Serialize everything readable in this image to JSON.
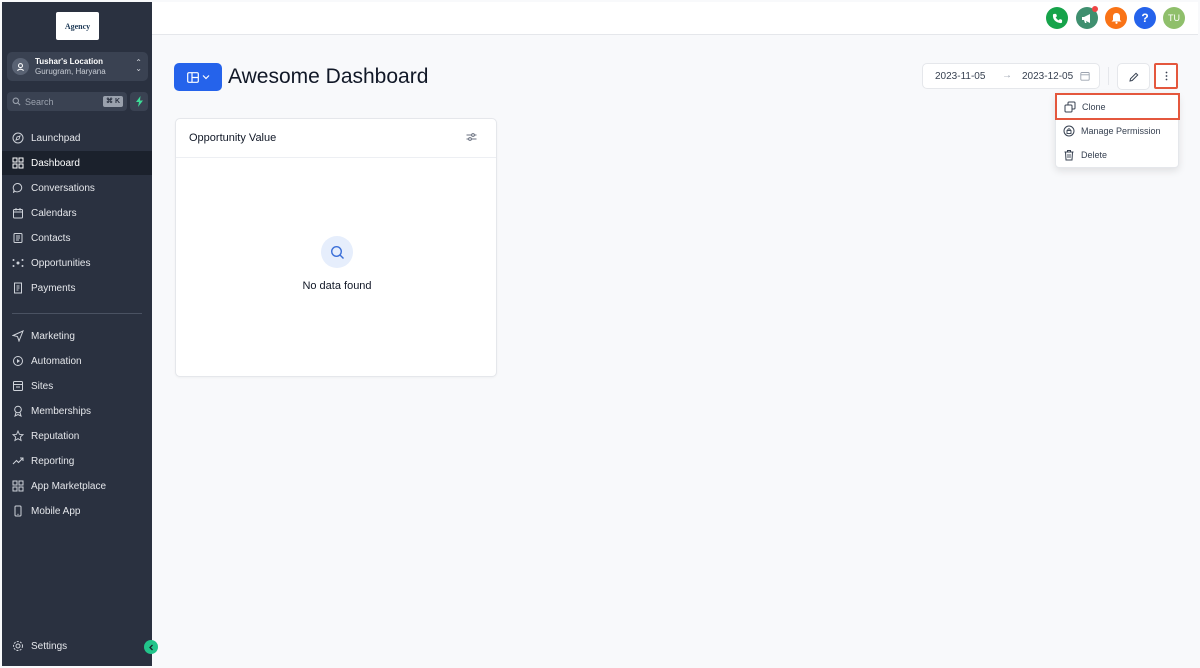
{
  "sidebar": {
    "logo_text": "Agency",
    "location": {
      "name": "Tushar's Location",
      "sub": "Gurugram, Haryana"
    },
    "search": {
      "placeholder": "Search",
      "shortcut": "⌘ K"
    },
    "items": [
      {
        "label": "Launchpad",
        "icon": "rocket-icon"
      },
      {
        "label": "Dashboard",
        "icon": "grid-icon",
        "active": true
      },
      {
        "label": "Conversations",
        "icon": "chat-bubble-icon"
      },
      {
        "label": "Calendars",
        "icon": "calendar-icon"
      },
      {
        "label": "Contacts",
        "icon": "contacts-icon"
      },
      {
        "label": "Opportunities",
        "icon": "pipeline-icon"
      },
      {
        "label": "Payments",
        "icon": "receipt-icon"
      }
    ],
    "items2": [
      {
        "label": "Marketing",
        "icon": "send-icon"
      },
      {
        "label": "Automation",
        "icon": "automation-icon"
      },
      {
        "label": "Sites",
        "icon": "globe-icon"
      },
      {
        "label": "Memberships",
        "icon": "award-icon"
      },
      {
        "label": "Reputation",
        "icon": "star-icon"
      },
      {
        "label": "Reporting",
        "icon": "trending-up-icon"
      },
      {
        "label": "App Marketplace",
        "icon": "apps-icon"
      },
      {
        "label": "Mobile App",
        "icon": "smartphone-icon"
      }
    ],
    "settings": {
      "label": "Settings",
      "icon": "gear-icon"
    }
  },
  "topbar": {
    "icons": [
      {
        "name": "phone-icon",
        "color": "#16a34a"
      },
      {
        "name": "megaphone-icon",
        "color": "#3f8f6f"
      },
      {
        "name": "bell-icon",
        "color": "#f97316"
      },
      {
        "name": "help-icon",
        "color": "#2563eb"
      }
    ],
    "avatar": {
      "initials": "TU",
      "color": "#8fbf6b"
    }
  },
  "header": {
    "title": "Awesome Dashboard",
    "date_start": "2023-11-05",
    "date_end": "2023-12-05"
  },
  "menu": {
    "items": [
      {
        "label": "Clone",
        "icon": "copy-icon"
      },
      {
        "label": "Manage Permission",
        "icon": "permission-icon"
      },
      {
        "label": "Delete",
        "icon": "trash-icon"
      }
    ]
  },
  "card": {
    "title": "Opportunity Value",
    "empty_text": "No data found"
  },
  "colors": {
    "sidebar_bg": "#2a3140",
    "accent": "#2563eb",
    "highlight_border": "#e4573d"
  }
}
